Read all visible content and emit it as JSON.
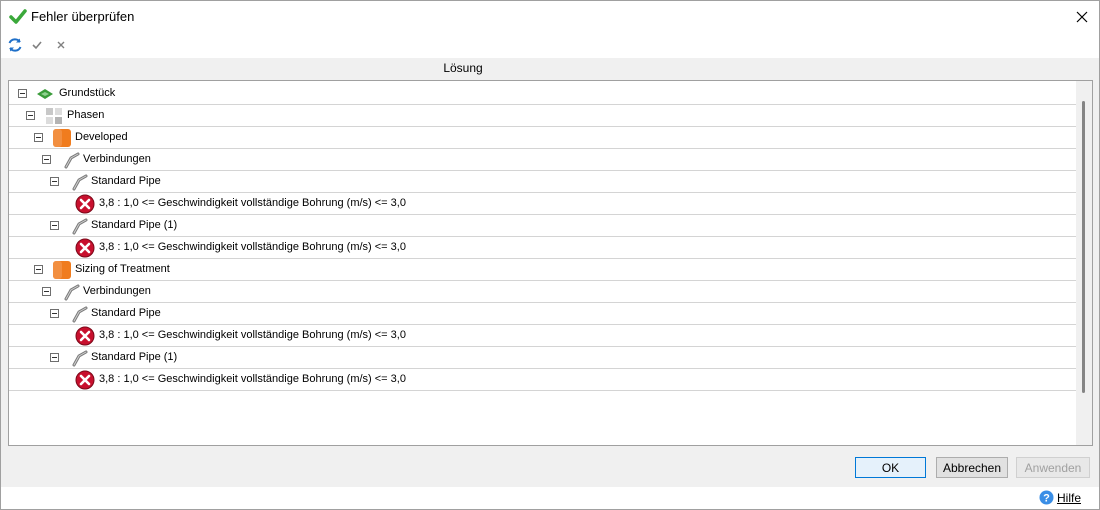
{
  "window": {
    "title": "Fehler überprüfen"
  },
  "toolbar": {
    "refresh_icon": "refresh-icon",
    "accept_icon": "check-icon",
    "reject_icon": "x-icon"
  },
  "tree": {
    "column_header": "Lösung",
    "rows": [
      {
        "label": "Grundstück",
        "icon": "site-icon",
        "level": 0
      },
      {
        "label": "Phasen",
        "icon": "phases-icon",
        "level": 1
      },
      {
        "label": "Developed",
        "icon": "phase-orange-icon",
        "level": 2
      },
      {
        "label": "Verbindungen",
        "icon": "pipe-icon",
        "level": 3
      },
      {
        "label": "Standard Pipe",
        "icon": "pipe-icon",
        "level": 4
      },
      {
        "label": "3,8 : 1,0 <= Geschwindigkeit vollständige Bohrung (m/s) <= 3,0",
        "icon": "error-icon",
        "level": 5
      },
      {
        "label": "Standard Pipe (1)",
        "icon": "pipe-icon",
        "level": 4
      },
      {
        "label": "3,8 : 1,0 <= Geschwindigkeit vollständige Bohrung (m/s) <= 3,0",
        "icon": "error-icon",
        "level": 5
      },
      {
        "label": "Sizing of Treatment",
        "icon": "phase-orange-icon",
        "level": 2
      },
      {
        "label": "Verbindungen",
        "icon": "pipe-icon",
        "level": 3
      },
      {
        "label": "Standard Pipe",
        "icon": "pipe-icon",
        "level": 4
      },
      {
        "label": "3,8 : 1,0 <= Geschwindigkeit vollständige Bohrung (m/s) <= 3,0",
        "icon": "error-icon",
        "level": 5
      },
      {
        "label": "Standard Pipe (1)",
        "icon": "pipe-icon",
        "level": 4
      },
      {
        "label": "3,8 : 1,0 <= Geschwindigkeit vollständige Bohrung (m/s) <= 3,0",
        "icon": "error-icon",
        "level": 5
      }
    ]
  },
  "buttons": {
    "ok": "OK",
    "cancel": "Abbrechen",
    "apply": "Anwenden"
  },
  "help": {
    "label": "Hilfe",
    "icon": "help-icon"
  },
  "colors": {
    "error": "#c8102e",
    "phase": "#f07c1e",
    "site_green": "#3a9c3a",
    "refresh_blue": "#1e6fc8",
    "primary_border": "#0078d7"
  }
}
